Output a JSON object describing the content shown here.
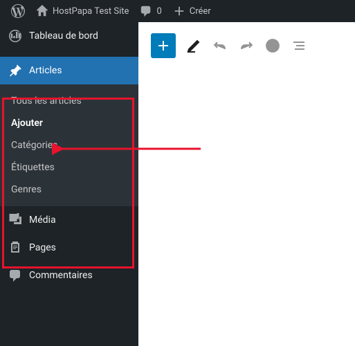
{
  "adminbar": {
    "site_name": "HostPapa Test Site",
    "comments_count": "0",
    "create_label": "Créer"
  },
  "sidebar": {
    "dashboard": "Tableau de bord",
    "posts": {
      "label": "Articles",
      "submenu": {
        "all": "Tous les articles",
        "add": "Ajouter",
        "categories": "Catégories",
        "tags": "Étiquettes",
        "genres": "Genres"
      }
    },
    "media": "Média",
    "pages": "Pages",
    "comments": "Commentaires"
  }
}
